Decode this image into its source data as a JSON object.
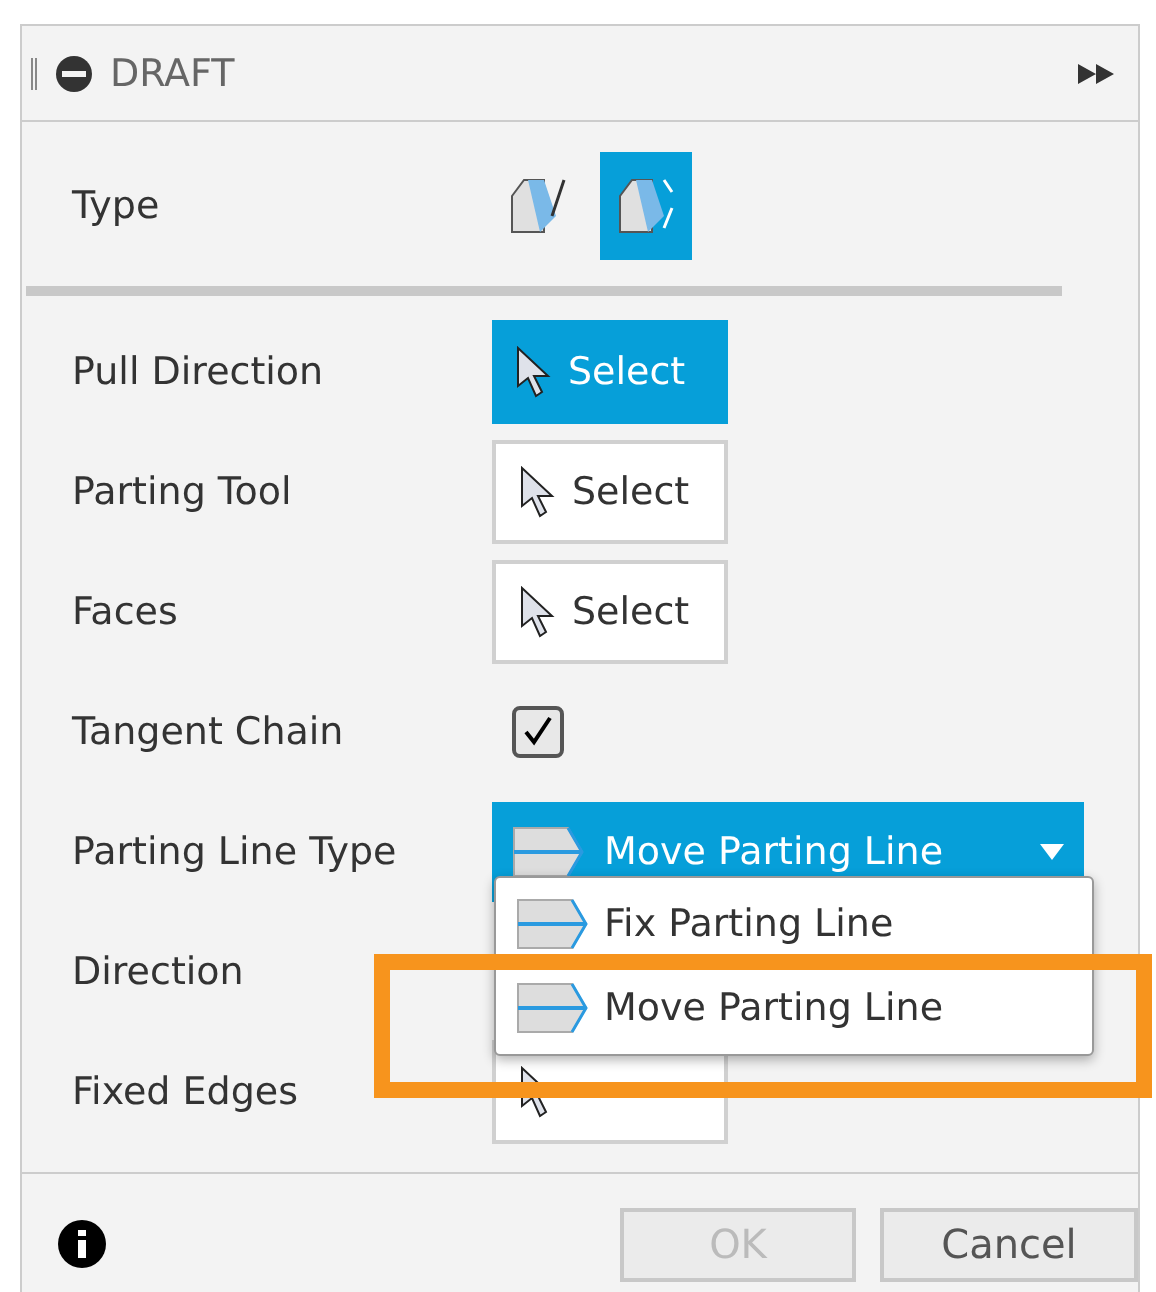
{
  "panel": {
    "title": "DRAFT"
  },
  "rows": [
    {
      "kind": "type",
      "label": "Type",
      "options": [
        {
          "selected": false
        },
        {
          "selected": true
        }
      ]
    },
    {
      "kind": "select",
      "label": "Pull Direction",
      "button": "Select",
      "active": true
    },
    {
      "kind": "select",
      "label": "Parting Tool",
      "button": "Select",
      "active": false
    },
    {
      "kind": "select",
      "label": "Faces",
      "button": "Select",
      "active": false
    },
    {
      "kind": "checkbox",
      "label": "Tangent Chain",
      "checked": true
    },
    {
      "kind": "dropdown",
      "label": "Parting Line Type",
      "value": "Move Parting Line",
      "expanded": true,
      "options": [
        {
          "label": "Fix Parting Line",
          "highlighted": false
        },
        {
          "label": "Move Parting Line",
          "highlighted": true
        }
      ]
    },
    {
      "kind": "blank",
      "label": "Direction"
    },
    {
      "kind": "select",
      "label": "Fixed Edges",
      "active": false
    }
  ],
  "footer": {
    "ok": {
      "label": "OK",
      "disabled": true
    },
    "cancel": {
      "label": "Cancel",
      "disabled": false
    }
  }
}
